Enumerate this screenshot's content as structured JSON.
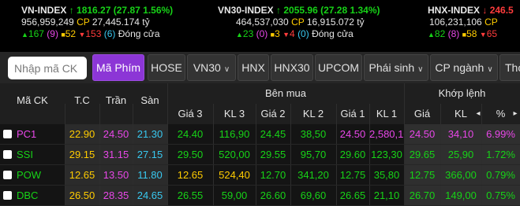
{
  "indices": [
    {
      "name": "VN-INDEX",
      "value": "1816.27",
      "change": "(27.87",
      "pct": "1.56%)",
      "volume": "956,959,249",
      "cp": "CP",
      "valuation": "27,445.174 tỷ",
      "up": "167",
      "ceil": "(9)",
      "ref": "52",
      "down": "153",
      "floor": "(6)",
      "status": "Đóng cửa"
    },
    {
      "name": "VN30-INDEX",
      "value": "2055.96",
      "change": "(27.28",
      "pct": "1.34%)",
      "volume": "464,537,030",
      "cp": "CP",
      "valuation": "16,915.072 tỷ",
      "up": "23",
      "ceil": "(0)",
      "ref": "3",
      "down": "4",
      "floor": "(0)",
      "status": "Đóng cửa"
    },
    {
      "name": "HNX-INDEX",
      "value": "246.5",
      "volume": "106,231,106",
      "cp": "CP",
      "up": "82",
      "ceil": "(8)",
      "ref": "58",
      "down": "65"
    }
  ],
  "toolbar": {
    "search_placeholder": "Nhập mã CK",
    "tabs": [
      "Mã Phím",
      "HOSE",
      "VN30",
      "HNX",
      "HNX30",
      "UPCOM",
      "Phái sinh",
      "CP ngành",
      "Thỏ"
    ]
  },
  "table": {
    "group_headers": {
      "ben_mua": "Bên mua",
      "khop_lenh": "Khớp lệnh"
    },
    "headers": [
      "Mã CK",
      "T.C",
      "Trần",
      "Sàn",
      "Giá 3",
      "KL 3",
      "Giá 2",
      "KL 2",
      "Giá 1",
      "KL 1",
      "Giá",
      "KL",
      "%"
    ],
    "sort_icons": {
      "left": "◂",
      "right": "▸",
      "kl_arrows": "⬍"
    },
    "rows": [
      {
        "symbol": "PC1",
        "tc": "22.90",
        "tran": "24.50",
        "san": "21.30",
        "g3": "24.40",
        "kl3": "116,90",
        "g2": "24.45",
        "kl2": "38,50",
        "g1": "24.50",
        "kl1": "2,580,10",
        "gia": "24.50",
        "kl": "34,10",
        "pct": "6.99%"
      },
      {
        "symbol": "SSI",
        "tc": "29.15",
        "tran": "31.15",
        "san": "27.15",
        "g3": "29.50",
        "kl3": "520,00",
        "g2": "29.55",
        "kl2": "95,70",
        "g1": "29.60",
        "kl1": "123,30",
        "gia": "29.65",
        "kl": "25,90",
        "pct": "1.72%"
      },
      {
        "symbol": "POW",
        "tc": "12.65",
        "tran": "13.50",
        "san": "11.80",
        "g3": "12.65",
        "kl3": "524,40",
        "g2": "12.70",
        "kl2": "341,20",
        "g1": "12.75",
        "kl1": "35,80",
        "gia": "12.75",
        "kl": "366,00",
        "pct": "0.79%"
      },
      {
        "symbol": "DBC",
        "tc": "26.50",
        "tran": "28.35",
        "san": "24.65",
        "g3": "26.55",
        "kl3": "59,00",
        "g2": "26.60",
        "kl2": "69,60",
        "g1": "26.65",
        "kl1": "21,10",
        "gia": "26.70",
        "kl": "149,00",
        "pct": "0.75%"
      }
    ]
  },
  "colors": {
    "up": "#17d317",
    "down": "#ff3c3c",
    "ref": "#ffcc00",
    "ceil": "#e847e8",
    "floor": "#38c8f0",
    "accent": "#8c36d6"
  }
}
